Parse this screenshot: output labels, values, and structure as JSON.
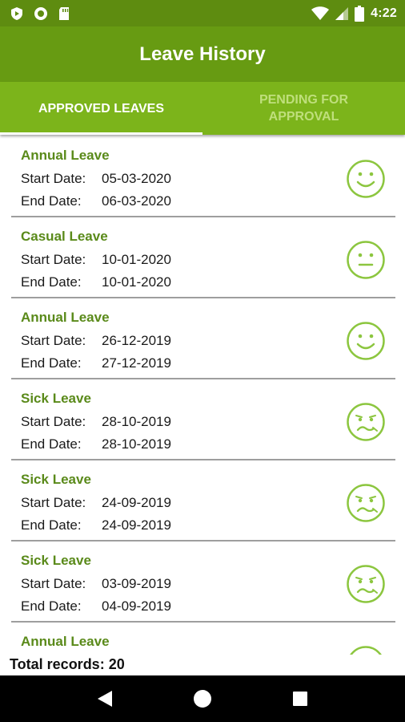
{
  "status_bar": {
    "time": "4:22",
    "left_icons": [
      "play-protect-icon",
      "record-icon",
      "sd-card-icon"
    ],
    "right_icons": [
      "wifi-icon",
      "cell-signal-icon",
      "battery-icon"
    ]
  },
  "app_bar": {
    "title": "Leave History"
  },
  "tabs": [
    {
      "label": "APPROVED LEAVES",
      "active": true
    },
    {
      "label": "PENDING FOR APPROVAL",
      "active": false
    }
  ],
  "labels": {
    "start": "Start Date:",
    "end": "End Date:"
  },
  "leaves": [
    {
      "type": "Annual Leave",
      "start": "05-03-2020",
      "end": "06-03-2020",
      "mood": "smile-icon"
    },
    {
      "type": "Casual Leave",
      "start": "10-01-2020",
      "end": "10-01-2020",
      "mood": "neutral-icon"
    },
    {
      "type": "Annual Leave",
      "start": "26-12-2019",
      "end": "27-12-2019",
      "mood": "smile-icon"
    },
    {
      "type": "Sick Leave",
      "start": "28-10-2019",
      "end": "28-10-2019",
      "mood": "sick-icon"
    },
    {
      "type": "Sick Leave",
      "start": "24-09-2019",
      "end": "24-09-2019",
      "mood": "sick-icon"
    },
    {
      "type": "Sick Leave",
      "start": "03-09-2019",
      "end": "04-09-2019",
      "mood": "sick-icon"
    },
    {
      "type": "Annual Leave",
      "start": "",
      "end": "",
      "mood": "smile-icon"
    }
  ],
  "footer": {
    "total": "Total records: 20"
  },
  "nav_bar": {
    "buttons": [
      "back-icon",
      "home-icon",
      "recents-icon"
    ]
  },
  "colors": {
    "status_bar": "#5e8c10",
    "app_bar": "#679b12",
    "tab_bar": "#7cb41b",
    "leave_type_text": "#5a8a1a",
    "mood_icon": "#8cc63f"
  }
}
